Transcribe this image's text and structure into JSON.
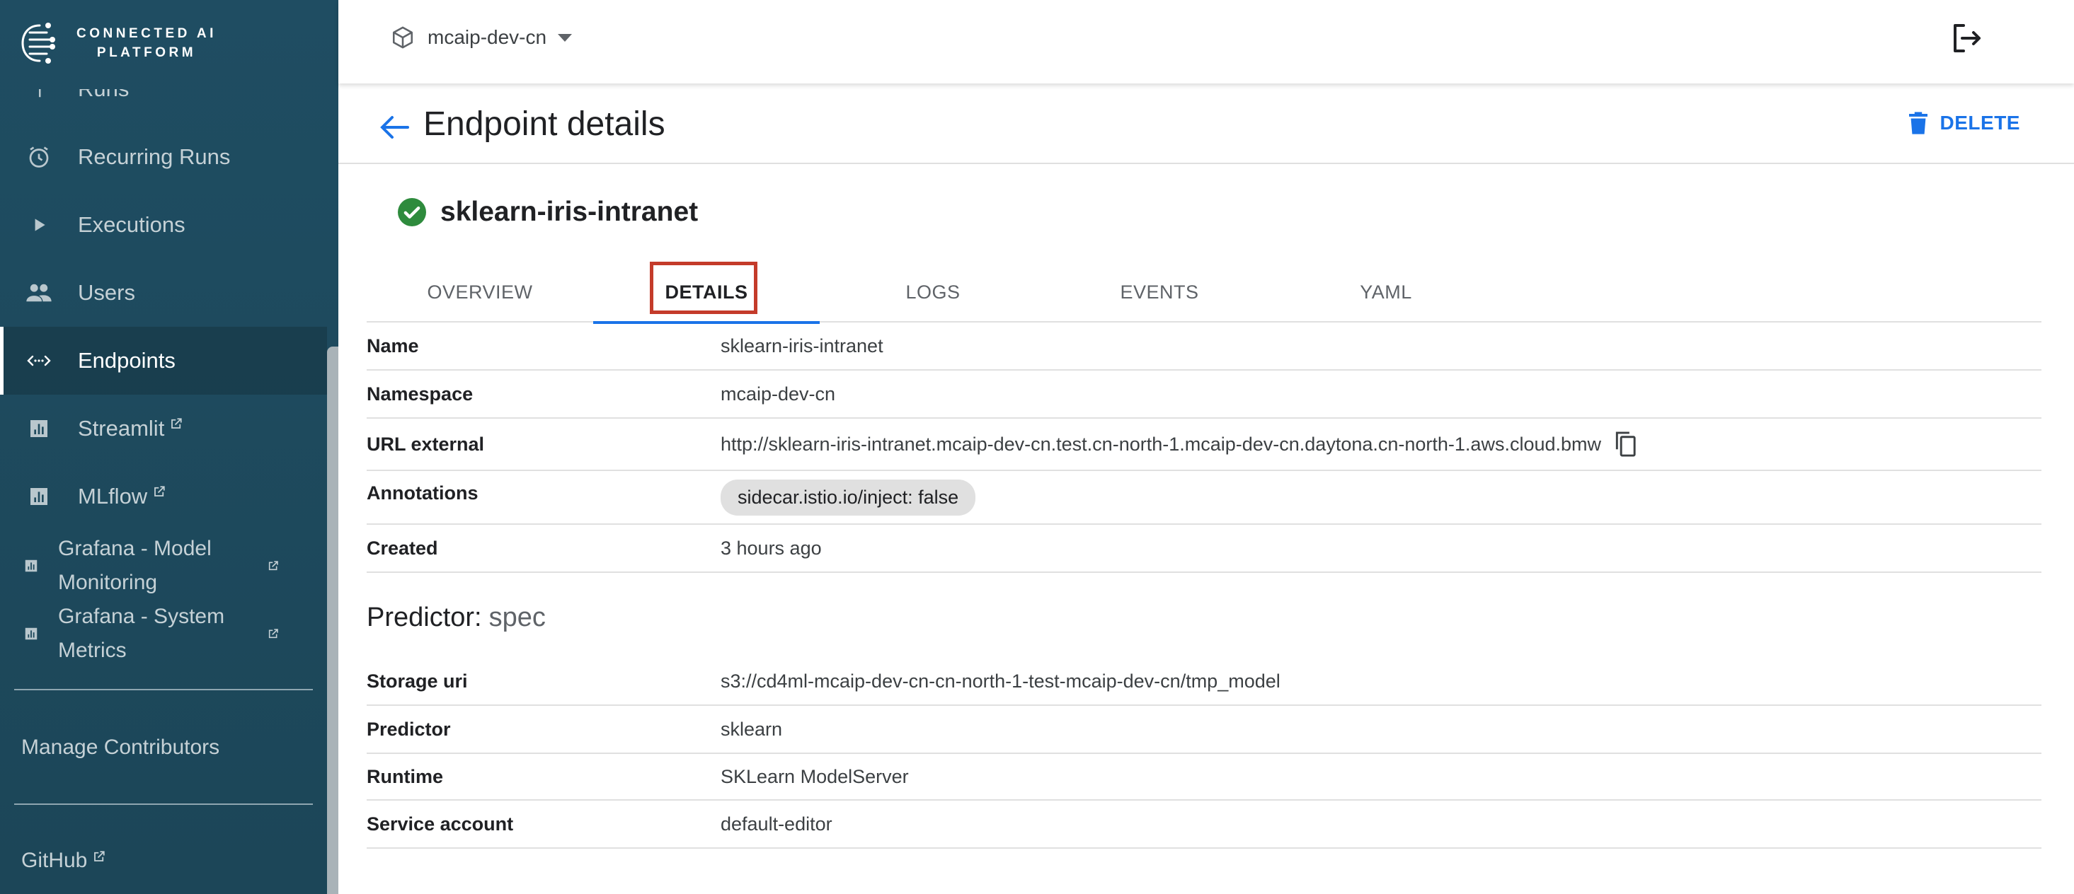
{
  "app": {
    "logo_line1": "CONNECTED AI",
    "logo_line2": "PLATFORM"
  },
  "sidebar": {
    "items": [
      {
        "label": "Runs",
        "icon": "runs-icon"
      },
      {
        "label": "Recurring Runs",
        "icon": "alarm-clock-icon"
      },
      {
        "label": "Executions",
        "icon": "play-icon"
      },
      {
        "label": "Users",
        "icon": "people-icon"
      },
      {
        "label": "Endpoints",
        "icon": "code-arrows-icon",
        "active": true
      },
      {
        "label": "Streamlit",
        "icon": "bar-chart-icon",
        "external": true
      },
      {
        "label": "MLflow",
        "icon": "bar-chart-icon",
        "external": true
      },
      {
        "label": "Grafana - Model Monitoring",
        "icon": "bar-chart-icon",
        "external": true
      },
      {
        "label": "Grafana - System Metrics",
        "icon": "bar-chart-icon",
        "external": true
      }
    ],
    "manage_contributors": "Manage Contributors",
    "github": "GitHub"
  },
  "topbar": {
    "namespace": "mcaip-dev-cn"
  },
  "header": {
    "title": "Endpoint details",
    "delete_label": "DELETE"
  },
  "resource": {
    "name": "sklearn-iris-intranet",
    "status": "ready",
    "status_color": "#2e8b3d"
  },
  "tabs": [
    {
      "label": "OVERVIEW"
    },
    {
      "label": "DETAILS",
      "active": true
    },
    {
      "label": "LOGS"
    },
    {
      "label": "EVENTS"
    },
    {
      "label": "YAML"
    }
  ],
  "details": {
    "name": {
      "key": "Name",
      "value": "sklearn-iris-intranet"
    },
    "namespace": {
      "key": "Namespace",
      "value": "mcaip-dev-cn"
    },
    "url_external": {
      "key": "URL external",
      "value": "http://sklearn-iris-intranet.mcaip-dev-cn.test.cn-north-1.mcaip-dev-cn.daytona.cn-north-1.aws.cloud.bmw"
    },
    "annotations": {
      "key": "Annotations",
      "value": "sidecar.istio.io/inject: false"
    },
    "created": {
      "key": "Created",
      "value": "3 hours ago"
    }
  },
  "predictor": {
    "title": "Predictor:",
    "subtitle": "spec",
    "rows": {
      "storage_uri": {
        "key": "Storage uri",
        "value": "s3://cd4ml-mcaip-dev-cn-cn-north-1-test-mcaip-dev-cn/tmp_model"
      },
      "predictor": {
        "key": "Predictor",
        "value": "sklearn"
      },
      "runtime": {
        "key": "Runtime",
        "value": "SKLearn ModelServer"
      },
      "service_account": {
        "key": "Service account",
        "value": "default-editor"
      }
    }
  },
  "colors": {
    "sidebar_bg": "#1f4d62",
    "accent": "#1a73e8",
    "highlight_box": "#c43b2a"
  }
}
